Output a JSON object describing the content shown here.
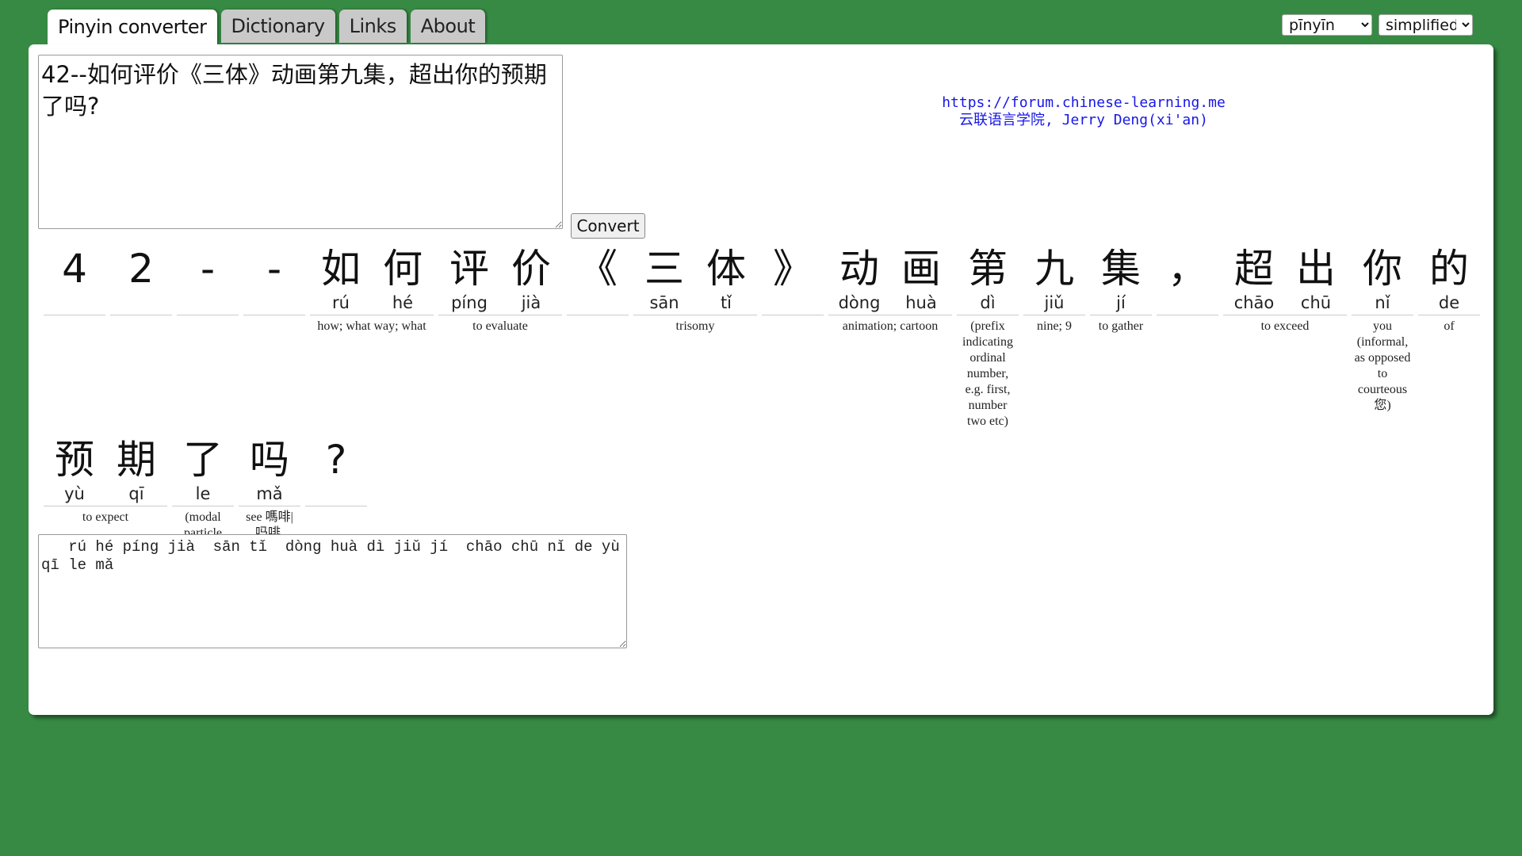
{
  "tabs": [
    {
      "label": "Pinyin converter",
      "active": true
    },
    {
      "label": "Dictionary",
      "active": false
    },
    {
      "label": "Links",
      "active": false
    },
    {
      "label": "About",
      "active": false
    }
  ],
  "tone_select": {
    "selected": "pīnyīn"
  },
  "script_select": {
    "selected": "simplified"
  },
  "input": {
    "text": "42--如何评价《三体》动画第九集，超出你的预期了吗?"
  },
  "convert_label": "Convert",
  "credit": {
    "url": "https://forum.chinese-learning.me",
    "name": "云联语言学院, Jerry Deng(xi'an)"
  },
  "rows": [
    [
      {
        "chars": [
          {
            "hz": "4",
            "py": ""
          }
        ],
        "def": ""
      },
      {
        "chars": [
          {
            "hz": "2",
            "py": ""
          }
        ],
        "def": ""
      },
      {
        "chars": [
          {
            "hz": "-",
            "py": ""
          }
        ],
        "def": ""
      },
      {
        "chars": [
          {
            "hz": "-",
            "py": ""
          }
        ],
        "def": ""
      },
      {
        "chars": [
          {
            "hz": "如",
            "py": "rú"
          },
          {
            "hz": "何",
            "py": "hé"
          }
        ],
        "def": "how; what way; what"
      },
      {
        "chars": [
          {
            "hz": "评",
            "py": "píng"
          },
          {
            "hz": "价",
            "py": "jià"
          }
        ],
        "def": "to evaluate"
      },
      {
        "chars": [
          {
            "hz": "《",
            "py": ""
          }
        ],
        "def": ""
      },
      {
        "chars": [
          {
            "hz": "三",
            "py": "sān"
          },
          {
            "hz": "体",
            "py": "tǐ"
          }
        ],
        "def": "trisomy"
      },
      {
        "chars": [
          {
            "hz": "》",
            "py": ""
          }
        ],
        "def": ""
      },
      {
        "chars": [
          {
            "hz": "动",
            "py": "dòng"
          },
          {
            "hz": "画",
            "py": "huà"
          }
        ],
        "def": "animation; cartoon"
      },
      {
        "chars": [
          {
            "hz": "第",
            "py": "dì"
          }
        ],
        "def": "(prefix indicating ordinal number, e.g. first, number two etc)"
      },
      {
        "chars": [
          {
            "hz": "九",
            "py": "jiǔ"
          }
        ],
        "def": "nine; 9"
      },
      {
        "chars": [
          {
            "hz": "集",
            "py": "jí"
          }
        ],
        "def": "to gather"
      },
      {
        "chars": [
          {
            "hz": "，",
            "py": ""
          }
        ],
        "def": ""
      },
      {
        "chars": [
          {
            "hz": "超",
            "py": "chāo"
          },
          {
            "hz": "出",
            "py": "chū"
          }
        ],
        "def": "to exceed"
      },
      {
        "chars": [
          {
            "hz": "你",
            "py": "nǐ"
          }
        ],
        "def": "you (informal, as opposed to courteous 您)"
      },
      {
        "chars": [
          {
            "hz": "的",
            "py": "de"
          }
        ],
        "def": "of"
      }
    ],
    [
      {
        "chars": [
          {
            "hz": "预",
            "py": "yù"
          },
          {
            "hz": "期",
            "py": "qī"
          }
        ],
        "def": "to expect"
      },
      {
        "chars": [
          {
            "hz": "了",
            "py": "le"
          }
        ],
        "def": "(modal particle intensifying preceding clause)"
      },
      {
        "chars": [
          {
            "hz": "吗",
            "py": "mǎ"
          }
        ],
        "def": "see 嗎啡|吗啡, morphine"
      },
      {
        "chars": [
          {
            "hz": "?",
            "py": ""
          }
        ],
        "def": ""
      }
    ]
  ],
  "output": {
    "text": "   rú hé píng jià  sān tǐ  dòng huà dì jiǔ jí  chāo chū nǐ de yù qī le mǎ "
  }
}
